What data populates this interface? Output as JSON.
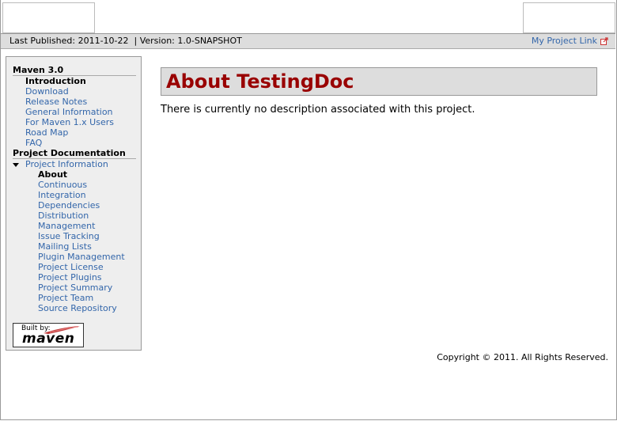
{
  "breadcrumbs": {
    "published": "Last Published: 2011-10-22",
    "separator": "|",
    "version": "Version: 1.0-SNAPSHOT",
    "project_link": "My Project Link"
  },
  "menu": {
    "section1": {
      "title": "Maven 3.0",
      "items": [
        "Introduction",
        "Download",
        "Release Notes",
        "General Information",
        "For Maven 1.x Users",
        "Road Map",
        "FAQ"
      ]
    },
    "section2": {
      "title": "Project Documentation",
      "parent": "Project Information",
      "items": [
        "About",
        "Continuous",
        "Integration",
        "Dependencies",
        "Distribution",
        "Management",
        "Issue Tracking",
        "Mailing Lists",
        "Plugin Management",
        "Project License",
        "Project Plugins",
        "Project Summary",
        "Project Team",
        "Source Repository"
      ]
    }
  },
  "built_by": {
    "label": "Built by:",
    "product": "maven"
  },
  "main": {
    "title": "About TestingDoc",
    "description": "There is currently no description associated with this project."
  },
  "footer": {
    "copyright": "Copyright © 2011. All Rights Reserved."
  },
  "colors": {
    "link": "#3366aa",
    "title": "#990000",
    "bar": "#dddddd"
  }
}
